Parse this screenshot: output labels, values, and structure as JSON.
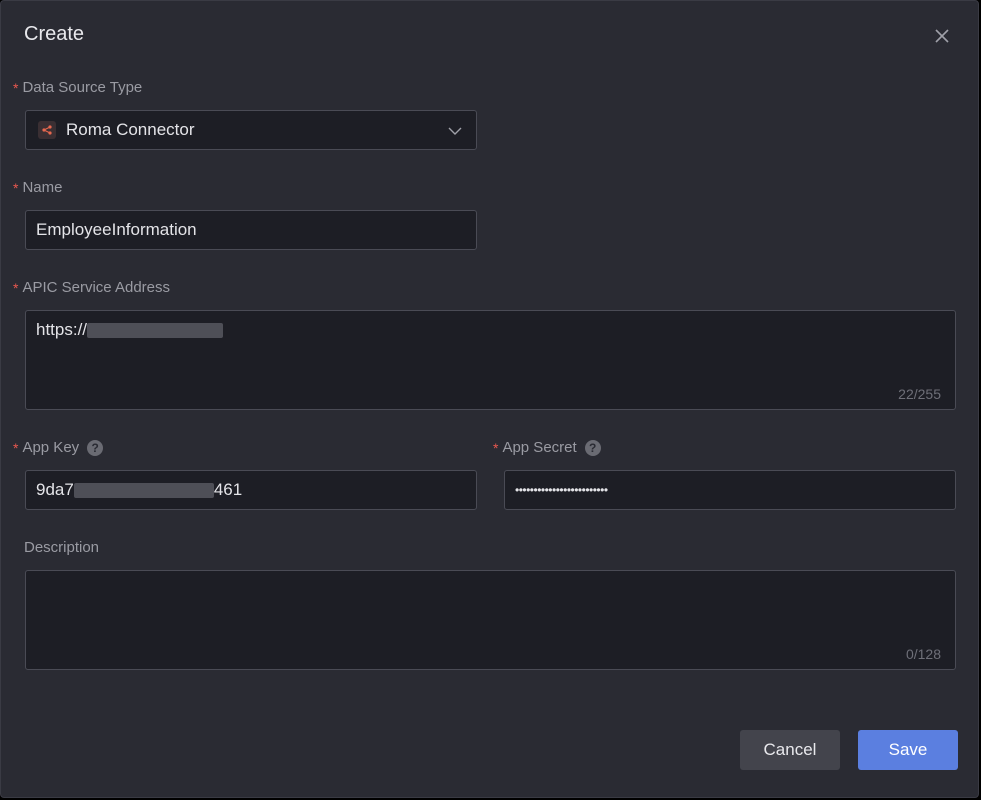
{
  "dialog": {
    "title": "Create"
  },
  "form": {
    "data_source_type": {
      "label": "Data Source Type",
      "required_mark": "*",
      "value": "Roma Connector",
      "icon": "roma-connector-icon"
    },
    "name": {
      "label": "Name",
      "required_mark": "*",
      "value": "EmployeeInformation"
    },
    "apic_service_address": {
      "label": "APIC Service Address",
      "required_mark": "*",
      "value_visible_prefix": "https://",
      "counter": "22/255"
    },
    "app_key": {
      "label": "App Key",
      "required_mark": "*",
      "value_visible_prefix": "9da7",
      "value_visible_suffix": "461",
      "help_glyph": "?"
    },
    "app_secret": {
      "label": "App Secret",
      "required_mark": "*",
      "value": "•••••••••••••••••••••••••",
      "help_glyph": "?"
    },
    "description": {
      "label": "Description",
      "value": "",
      "counter": "0/128"
    }
  },
  "buttons": {
    "cancel": "Cancel",
    "save": "Save"
  },
  "colors": {
    "background": "#2a2b33",
    "field_background": "#1d1e25",
    "required": "#e8584f",
    "primary": "#5b7fe0"
  }
}
